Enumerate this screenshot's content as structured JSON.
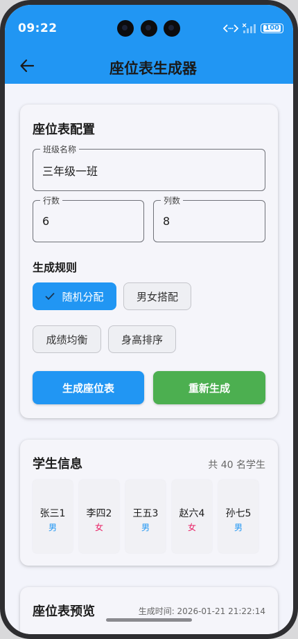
{
  "status": {
    "time": "09:22",
    "battery": "100"
  },
  "appbar": {
    "title": "座位表生成器"
  },
  "config": {
    "title": "座位表配置",
    "class_name": {
      "label": "班级名称",
      "value": "三年级一班"
    },
    "rows": {
      "label": "行数",
      "value": "6"
    },
    "cols": {
      "label": "列数",
      "value": "8"
    },
    "rules_title": "生成规则",
    "rules": [
      {
        "label": "随机分配",
        "selected": true
      },
      {
        "label": "男女搭配",
        "selected": false
      },
      {
        "label": "成绩均衡",
        "selected": false
      },
      {
        "label": "身高排序",
        "selected": false
      }
    ],
    "generate_label": "生成座位表",
    "regenerate_label": "重新生成"
  },
  "students": {
    "title": "学生信息",
    "count_text": "共 40 名学生",
    "items": [
      {
        "name": "张三1",
        "gender": "男"
      },
      {
        "name": "李四2",
        "gender": "女"
      },
      {
        "name": "王五3",
        "gender": "男"
      },
      {
        "name": "赵六4",
        "gender": "女"
      },
      {
        "name": "孙七5",
        "gender": "男"
      }
    ]
  },
  "preview": {
    "title": "座位表预览",
    "time_text": "生成时间: 2026-01-21 21:22:14"
  },
  "colors": {
    "primary": "#2196f3",
    "success": "#4caf50",
    "male": "#2196f3",
    "female": "#e91e63"
  }
}
